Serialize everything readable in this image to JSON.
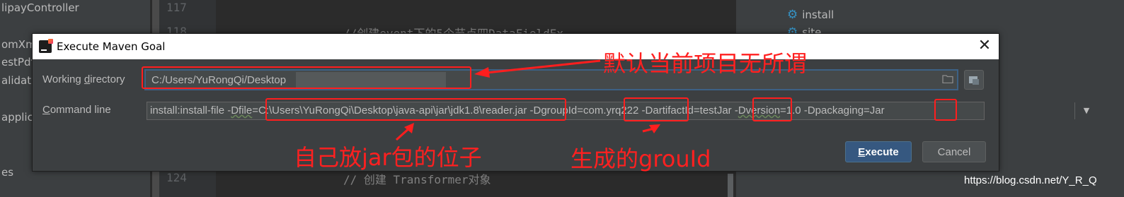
{
  "project_tree": {
    "items": [
      "lipayController",
      "omXm",
      "estPdf",
      "alidate",
      "applica",
      "es"
    ]
  },
  "editor": {
    "line_numbers": [
      "117",
      "118",
      "124"
    ],
    "code_lines": [
      "//创建event下的5个节点四DataFieldEx",
      "// 创建 Transformer对象"
    ]
  },
  "maven_panel": {
    "items": [
      "install",
      "site"
    ]
  },
  "dialog": {
    "title": "Execute Maven Goal",
    "working_directory": {
      "label_pre": "Working ",
      "label_mnemonic": "d",
      "label_post": "irectory",
      "value": "C:/Users/YuRongQi/Desktop"
    },
    "command_line": {
      "label_mnemonic": "C",
      "label_post": "ommand line",
      "parts": {
        "goal": "install:install-file ",
        "p1": "-",
        "p1_key": "Dfile",
        "file": "=C:\\Users\\YuRongQi\\Desktop\\java-api\\jar\\jdk1.8\\reader.jar",
        "group_key": " -DgroupId",
        "group": "=com.yrq222",
        "artifact_key": " -DartifactId",
        "artifact": "=testJar",
        "rest_pre": " -",
        "version_key": "Dversion",
        "version": "=1.0",
        "packaging_key": " -Dpackaging",
        "packaging": "=Jar"
      }
    },
    "execute_mnemonic": "E",
    "execute_post": "xecute",
    "cancel_label": "Cancel"
  },
  "annotations": {
    "default_note": "默认当前项目无所谓",
    "jar_note": "自己放jar包的位子",
    "group_note": "生成的grouId"
  },
  "watermark": "https://blog.csdn.net/Y_R_Q",
  "colors": {
    "annotation_red": "#ff1e1e",
    "primary_button": "#365880",
    "dialog_bg": "#3c3f41"
  }
}
